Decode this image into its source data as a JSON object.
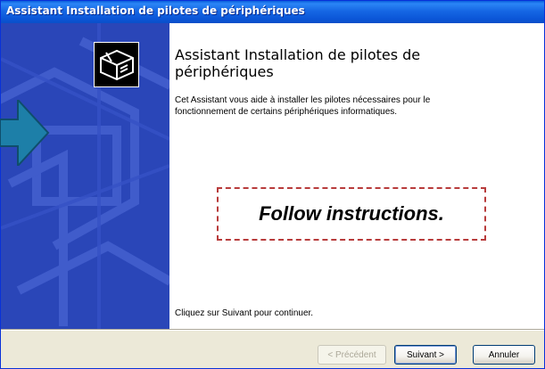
{
  "window": {
    "title": "Assistant Installation de pilotes de périphériques"
  },
  "wizard": {
    "heading": "Assistant Installation de pilotes de périphériques",
    "description": "Cet Assistant vous aide à installer les pilotes nécessaires pour le fonctionnement de certains périphériques informatiques.",
    "continue_hint": "Cliquez sur Suivant pour continuer."
  },
  "annotation": {
    "text": "Follow instructions."
  },
  "buttons": {
    "back": "< Précédent",
    "next": "Suivant >",
    "cancel": "Annuler"
  },
  "icons": {
    "wizard_icon": "hardware-installer-icon",
    "pointer": "arrow-right-icon"
  },
  "colors": {
    "titlebar": "#0a5ddc",
    "panel": "#2a46b8",
    "annotation_border": "#b83c3c",
    "arrow": "#1d7fa8"
  }
}
